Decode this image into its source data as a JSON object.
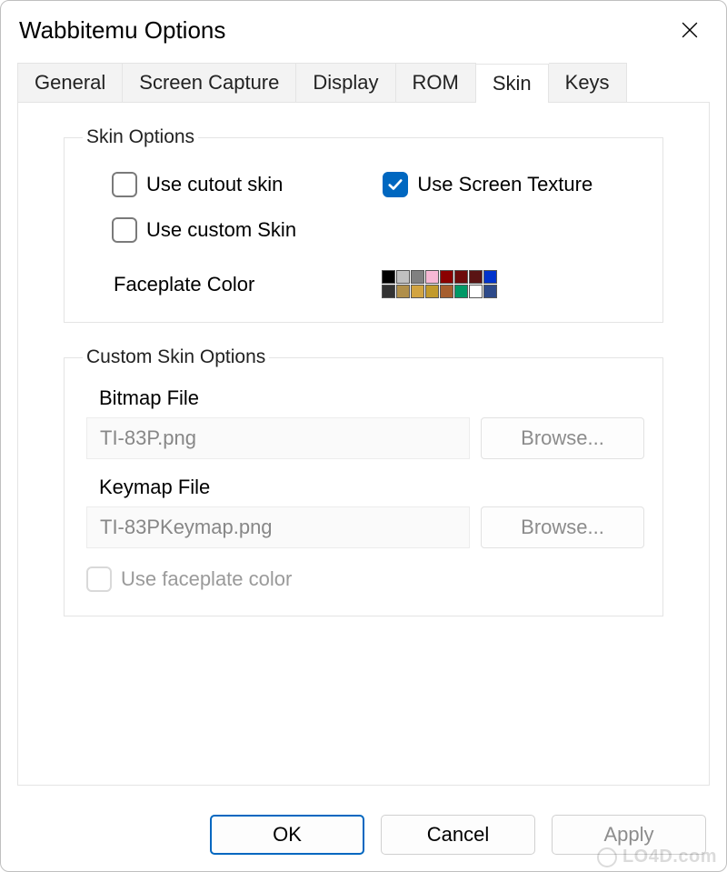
{
  "window": {
    "title": "Wabbitemu Options"
  },
  "tabs": {
    "general": "General",
    "screen_capture": "Screen Capture",
    "display": "Display",
    "rom": "ROM",
    "skin": "Skin",
    "keys": "Keys",
    "active": "skin"
  },
  "skin_options": {
    "legend": "Skin Options",
    "use_cutout": {
      "label": "Use cutout skin",
      "checked": false
    },
    "use_screen_texture": {
      "label": "Use Screen Texture",
      "checked": true
    },
    "use_custom_skin": {
      "label": "Use custom Skin",
      "checked": false
    },
    "faceplate_label": "Faceplate Color",
    "faceplate_colors": [
      "#000000",
      "#c0c0c0",
      "#808080",
      "#f7b8d4",
      "#8b0000",
      "#6e0c0c",
      "#5a1414",
      "#0033cc",
      "#333333",
      "#b08f4a",
      "#d2a441",
      "#c29a2c",
      "#a65e2e",
      "#009966",
      "#ffffff",
      "#2e4a8a"
    ]
  },
  "custom_skin": {
    "legend": "Custom Skin Options",
    "bitmap_label": "Bitmap File",
    "bitmap_value": "TI-83P.png",
    "keymap_label": "Keymap File",
    "keymap_value": "TI-83PKeymap.png",
    "browse_label": "Browse...",
    "use_faceplate": {
      "label": "Use faceplate color",
      "checked": false,
      "disabled": true
    }
  },
  "buttons": {
    "ok": "OK",
    "cancel": "Cancel",
    "apply": "Apply"
  },
  "watermark": "LO4D.com"
}
